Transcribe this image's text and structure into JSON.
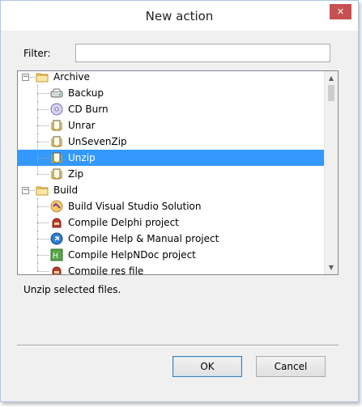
{
  "window": {
    "title": "New action",
    "close_glyph": "✕"
  },
  "filter": {
    "label": "Filter:",
    "value": "",
    "placeholder": ""
  },
  "tree": {
    "items": [
      {
        "label": "Archive",
        "level": 0,
        "type": "group",
        "icon": "folder-icon"
      },
      {
        "label": "Backup",
        "level": 1,
        "type": "action",
        "icon": "hard-drive-icon"
      },
      {
        "label": "CD Burn",
        "level": 1,
        "type": "action",
        "icon": "cd-icon"
      },
      {
        "label": "Unrar",
        "level": 1,
        "type": "action",
        "icon": "archive-clamp-icon"
      },
      {
        "label": "UnSevenZip",
        "level": 1,
        "type": "action",
        "icon": "archive-clamp-icon"
      },
      {
        "label": "Unzip",
        "level": 1,
        "type": "action",
        "icon": "archive-clamp-icon",
        "selected": true
      },
      {
        "label": "Zip",
        "level": 1,
        "type": "action",
        "icon": "archive-clamp-icon"
      },
      {
        "label": "Build",
        "level": 0,
        "type": "group",
        "icon": "folder-icon"
      },
      {
        "label": "Build Visual Studio Solution",
        "level": 1,
        "type": "action",
        "icon": "visual-studio-icon"
      },
      {
        "label": "Compile Delphi project",
        "level": 1,
        "type": "action",
        "icon": "delphi-helmet-icon"
      },
      {
        "label": "Compile Help & Manual project",
        "level": 1,
        "type": "action",
        "icon": "help-manual-icon"
      },
      {
        "label": "Compile HelpNDoc project",
        "level": 1,
        "type": "action",
        "icon": "helpndoc-icon"
      },
      {
        "label": "Compile res file",
        "level": 1,
        "type": "action",
        "icon": "delphi-helmet-icon"
      }
    ]
  },
  "description": {
    "text": "Unzip selected files."
  },
  "buttons": {
    "ok": "OK",
    "cancel": "Cancel"
  },
  "colors": {
    "selection": "#3399ff",
    "folder": "#e8c56b"
  }
}
